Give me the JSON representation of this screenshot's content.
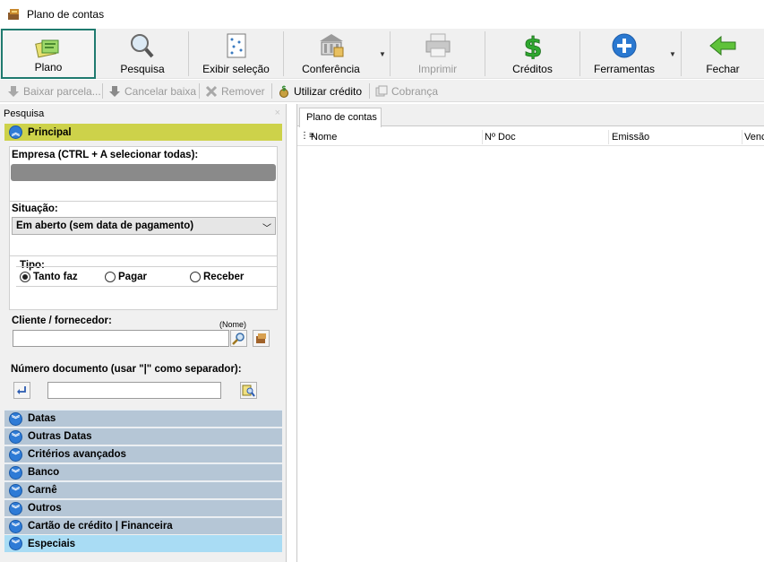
{
  "window": {
    "title": "Plano de contas"
  },
  "toolbar": {
    "plano": "Plano",
    "pesquisa": "Pesquisa",
    "exibir_selecao": "Exibir seleção",
    "conferencia": "Conferência",
    "imprimir": "Imprimir",
    "creditos": "Créditos",
    "ferramentas": "Ferramentas",
    "fechar": "Fechar"
  },
  "subtoolbar": {
    "baixar_parcela": "Baixar parcela...",
    "cancelar_baixa": "Cancelar baixa",
    "remover": "Remover",
    "utilizar_credito": "Utilizar crédito",
    "cobranca": "Cobrança"
  },
  "search_panel": {
    "title": "Pesquisa",
    "principal": "Principal",
    "empresa_label": "Empresa (CTRL + A selecionar todas):",
    "situacao_label": "Situação:",
    "situacao_value": "Em aberto (sem data de pagamento)",
    "tipo_label": "Tipo:",
    "tipo_options": [
      "Tanto faz",
      "Pagar",
      "Receber"
    ],
    "tipo_selected": "Tanto faz",
    "cliente_label": "Cliente / fornecedor:",
    "cliente_hint": "(Nome)",
    "cliente_value": "",
    "numero_label": "Número documento (usar \"|\" como separador):",
    "numero_value": "",
    "groups": [
      "Datas",
      "Outras Datas",
      "Critérios avançados",
      "Banco",
      "Carnê",
      "Outros",
      "Cartão de crédito | Financeira",
      "Especiais"
    ]
  },
  "results": {
    "tab": "Plano de contas",
    "columns": [
      "Nome",
      "Nº Doc",
      "Emissão",
      "Venc"
    ]
  },
  "colors": {
    "principal_header": "#cdd24a",
    "group_header": "#b5c6d6",
    "special_header": "#a9dcf4",
    "active_border": "#1f7a6f",
    "credit_green": "#2fa82f",
    "tools_blue": "#2a78d0"
  }
}
